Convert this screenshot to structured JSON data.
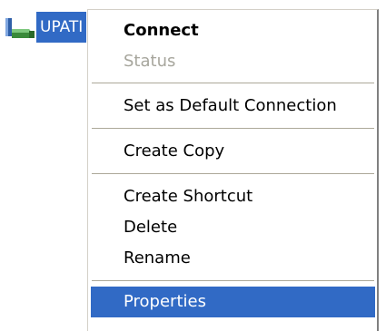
{
  "desktop": {
    "connection_label": "UPATI",
    "connection_icon": "network-connection-icon"
  },
  "context_menu": {
    "items": [
      {
        "label": "Connect",
        "style": "default-bold"
      },
      {
        "label": "Status",
        "state": "disabled"
      },
      {
        "label": "Set as Default Connection"
      },
      {
        "label": "Create Copy"
      },
      {
        "label": "Create Shortcut"
      },
      {
        "label": "Delete"
      },
      {
        "label": "Rename"
      },
      {
        "label": "Properties",
        "state": "highlighted"
      }
    ]
  },
  "colors": {
    "highlight": "#316ac5",
    "highlight_text": "#ffffff",
    "disabled_text": "#a7a69d",
    "separator": "#aca899"
  }
}
